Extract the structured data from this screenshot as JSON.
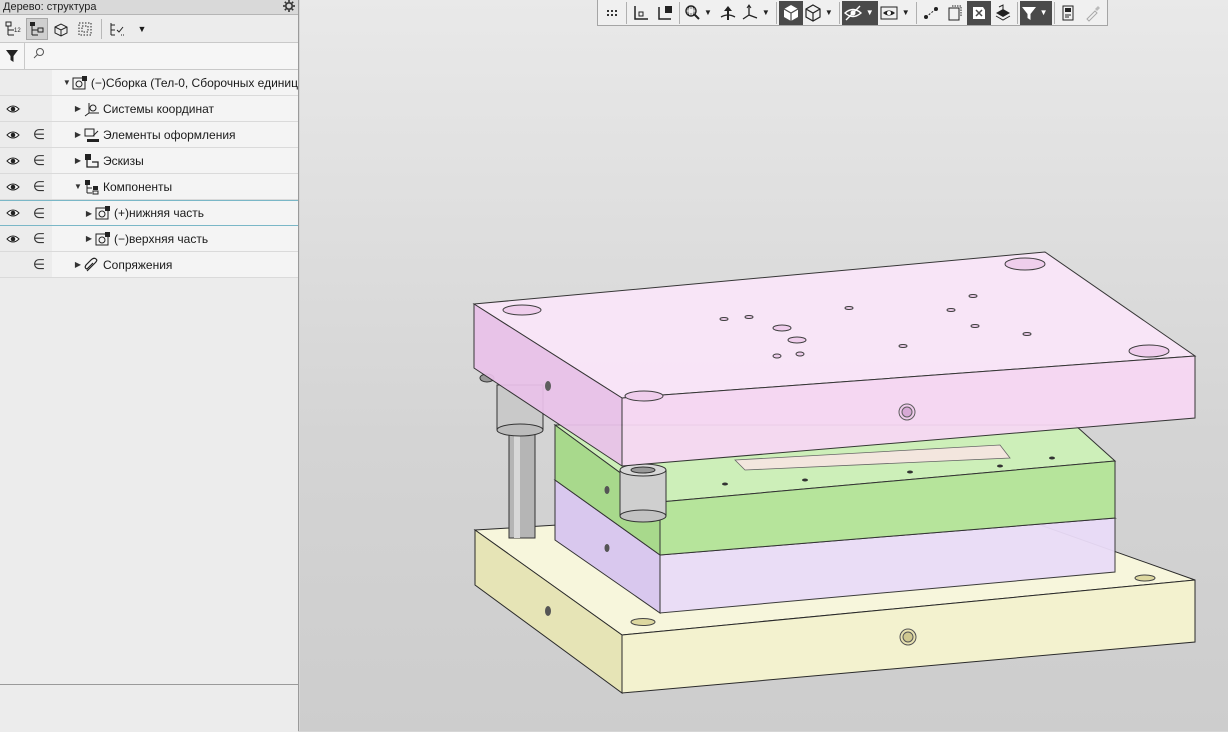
{
  "panel": {
    "title": "Дерево: структура",
    "search": {
      "placeholder": "",
      "value": ""
    }
  },
  "tree": {
    "rows": [
      {
        "label": "(−)Сборка (Тел-0, Сборочных единиц",
        "eye": false,
        "incl": false,
        "expanded": true,
        "level": 0,
        "icon": "assembly-icon"
      },
      {
        "label": "Системы координат",
        "eye": true,
        "incl": false,
        "expanded": false,
        "level": 1,
        "icon": "coordinate-system-icon"
      },
      {
        "label": "Элементы оформления",
        "eye": true,
        "incl": true,
        "expanded": false,
        "level": 1,
        "icon": "annotation-icon"
      },
      {
        "label": "Эскизы",
        "eye": true,
        "incl": true,
        "expanded": false,
        "level": 1,
        "icon": "sketch-icon"
      },
      {
        "label": "Компоненты",
        "eye": true,
        "incl": true,
        "expanded": true,
        "level": 1,
        "icon": "components-icon"
      },
      {
        "label": "(+)нижняя часть",
        "eye": true,
        "incl": true,
        "expanded": false,
        "level": 2,
        "icon": "part-icon"
      },
      {
        "label": "(−)верхняя часть",
        "eye": true,
        "incl": true,
        "expanded": false,
        "level": 2,
        "icon": "part-icon"
      },
      {
        "label": "Сопряжения",
        "eye": false,
        "incl": true,
        "expanded": false,
        "level": 1,
        "icon": "mates-icon"
      }
    ]
  },
  "colors": {
    "top_plate": "#f7d3f3",
    "middle_green": "#b8e6a0",
    "lower_lavender": "#e3d0f0",
    "base_plate": "#f4f3cf"
  }
}
